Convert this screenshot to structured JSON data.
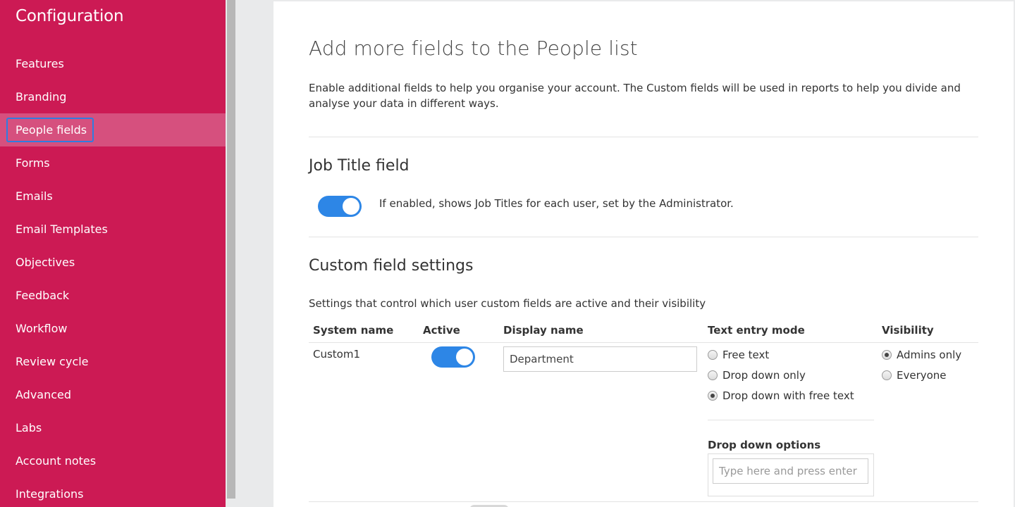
{
  "sidebar": {
    "title": "Configuration",
    "items": [
      {
        "label": "Features"
      },
      {
        "label": "Branding"
      },
      {
        "label": "People fields"
      },
      {
        "label": "Forms"
      },
      {
        "label": "Emails"
      },
      {
        "label": "Email Templates"
      },
      {
        "label": "Objectives"
      },
      {
        "label": "Feedback"
      },
      {
        "label": "Workflow"
      },
      {
        "label": "Review cycle"
      },
      {
        "label": "Advanced"
      },
      {
        "label": "Labs"
      },
      {
        "label": "Account notes"
      },
      {
        "label": "Integrations"
      }
    ],
    "active_index": 2,
    "bg_color": "#cc1a54",
    "active_bg_color": "#d6507e"
  },
  "main": {
    "title": "Add more fields to the People list",
    "intro": "Enable additional fields to help you organise your account. The Custom fields will be used in reports to help you divide and analyse your data in different ways.",
    "job_title": {
      "heading": "Job Title field",
      "toggle_on": true,
      "help": "If enabled, shows Job Titles for each user, set by the Administrator."
    },
    "custom": {
      "heading": "Custom field settings",
      "description": "Settings that control which user custom fields are active and their visibility",
      "columns": {
        "system_name": "System name",
        "active": "Active",
        "display_name": "Display name",
        "text_entry_mode": "Text entry mode",
        "visibility": "Visibility"
      },
      "row": {
        "system_name": "Custom1",
        "active": true,
        "display_name": "Department",
        "text_entry_options": [
          "Free text",
          "Drop down only",
          "Drop down with free text"
        ],
        "text_entry_selected": 2,
        "visibility_options": [
          "Admins only",
          "Everyone"
        ],
        "visibility_selected": 0,
        "dropdown_options_label": "Drop down options",
        "dropdown_placeholder": "Type here and press enter"
      }
    },
    "accent_color": "#2d86e6"
  }
}
